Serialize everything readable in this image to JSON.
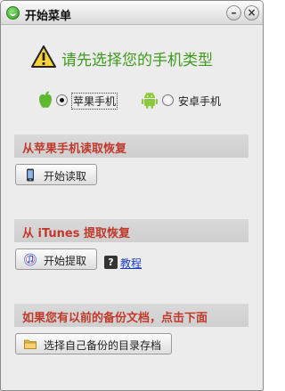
{
  "window": {
    "title": "开始菜单",
    "minimize_glyph": "–",
    "close_glyph": "×"
  },
  "heading": {
    "text": "请先选择您的手机类型",
    "icon": "warning-icon"
  },
  "phone_type": {
    "options": [
      {
        "label": "苹果手机",
        "icon": "apple-icon",
        "selected": true
      },
      {
        "label": "安卓手机",
        "icon": "android-icon",
        "selected": false
      }
    ]
  },
  "sections": {
    "iphone_restore": {
      "title": "从苹果手机读取恢复",
      "button_label": "开始读取",
      "button_icon": "phone-icon"
    },
    "itunes_restore": {
      "title": "从 iTunes 提取恢复",
      "button_label": "开始提取",
      "button_icon": "itunes-icon",
      "help_glyph": "?",
      "help_link": "教程"
    },
    "backup_restore": {
      "title": "如果您有以前的备份文档，点击下面",
      "button_label": "选择自己备份的目录存档",
      "button_icon": "folder-icon"
    }
  },
  "colors": {
    "heading_green": "#3f9a1e",
    "section_red": "#c0392b",
    "link_blue": "#1a3fc7"
  }
}
